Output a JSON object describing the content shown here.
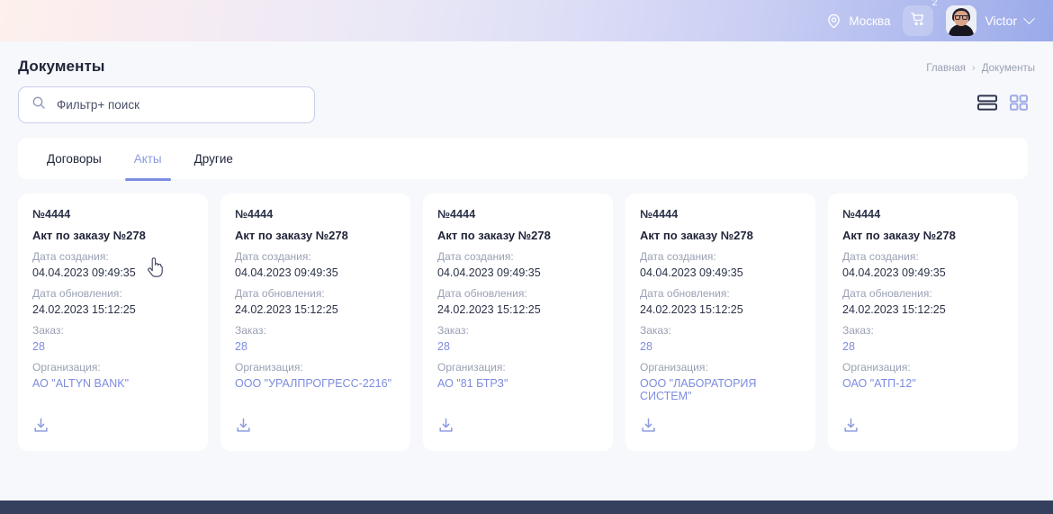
{
  "topbar": {
    "city": "Москва",
    "city_icon": "location-pin-icon",
    "cart_icon": "shopping-cart-icon",
    "cart_badge": "2",
    "user_name": "Victor",
    "chevron_icon": "chevron-down-icon"
  },
  "header": {
    "title": "Документы",
    "breadcrumb": {
      "home": "Главная",
      "separator": "›",
      "current": "Документы"
    }
  },
  "search": {
    "icon": "search-icon",
    "placeholder": "Фильтр+ поиск",
    "value": ""
  },
  "view_toggle": {
    "list_icon": "list-view-icon",
    "grid_icon": "grid-view-icon",
    "active": "list"
  },
  "tabs": [
    {
      "label": "Договоры",
      "active": false
    },
    {
      "label": "Акты",
      "active": true
    },
    {
      "label": "Другие",
      "active": false
    }
  ],
  "card_labels": {
    "created": "Дата создания:",
    "updated": "Дата обновления:",
    "order": "Заказ:",
    "organization": "Организация:",
    "download_icon": "download-icon"
  },
  "cards": [
    {
      "number": "№4444",
      "title": "Акт по заказу №278",
      "created": "04.04.2023 09:49:35",
      "updated": "24.02.2023 15:12:25",
      "order": "28",
      "organization": "АО \"ALTYN BANK\""
    },
    {
      "number": "№4444",
      "title": "Акт по заказу №278",
      "created": "04.04.2023 09:49:35",
      "updated": "24.02.2023 15:12:25",
      "order": "28",
      "organization": "ООО \"УРАЛПРОГРЕСС-2216\""
    },
    {
      "number": "№4444",
      "title": "Акт по заказу №278",
      "created": "04.04.2023 09:49:35",
      "updated": "24.02.2023 15:12:25",
      "order": "28",
      "organization": "АО \"81 БТРЗ\""
    },
    {
      "number": "№4444",
      "title": "Акт по заказу №278",
      "created": "04.04.2023 09:49:35",
      "updated": "24.02.2023 15:12:25",
      "order": "28",
      "organization": "ООО \"ЛАБОРАТОРИЯ СИСТЕМ\""
    },
    {
      "number": "№4444",
      "title": "Акт по заказу №278",
      "created": "04.04.2023 09:49:35",
      "updated": "24.02.2023 15:12:25",
      "order": "28",
      "organization": "ОАО \"АТП-12\""
    }
  ],
  "colors": {
    "accent": "#7D8CDF",
    "text": "#1F2438",
    "muted": "#9AA1B4",
    "footer": "#35405F"
  },
  "cursor": {
    "type": "pointer-hand-cursor"
  }
}
